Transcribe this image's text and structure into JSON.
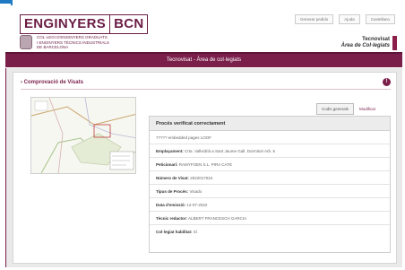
{
  "header": {
    "logo_left": "ENGINYERS",
    "logo_right": "BCN",
    "sub_line1": "COL·LEGI D'ENGINYERS GRADUATS",
    "sub_line2": "I ENGINYERS TÈCNICS INDUSTRIALS",
    "sub_line3": "DE BARCELONA",
    "links": [
      "Generar pedido",
      "Ajuda",
      "Castellano"
    ],
    "brand_line1": "Tecnovisat",
    "brand_line2": "Àrea de Col·legiats"
  },
  "nav": {
    "title": "Tecnovisat - Àrea de col·legiats"
  },
  "page": {
    "title": "Comprovació de Visats",
    "info_icon": "!",
    "buttons": {
      "print": "Codis generals",
      "back": "Modificar"
    }
  },
  "panel": {
    "heading": "Procés verificat correctament",
    "rows": [
      {
        "label": "",
        "value": "????? embedded pages LOOF"
      },
      {
        "label": "Emplaçament:",
        "value": "Crta. Vallvidrià a Sant Jaume Gall. Dormitori Arb. 5"
      },
      {
        "label": "Peticionari:",
        "value": "RAMYFOEN S.L. PIRA CATE"
      },
      {
        "label": "Número de Visat:",
        "value": "2022017024"
      },
      {
        "label": "Tipus de Procés:",
        "value": "Visado"
      },
      {
        "label": "Data d'emissió:",
        "value": "12-07-2022"
      },
      {
        "label": "Tècnic redactor:",
        "value": "ALBERT FRANCESCH GARCIA"
      },
      {
        "label": "Col·legiat habilitat:",
        "value": "Sí"
      }
    ]
  },
  "colors": {
    "brand": "#7a1e4a",
    "accent_blue": "#1f7ac4"
  },
  "icons": {
    "info": "info-icon",
    "seal": "seal-icon",
    "map": "map-thumbnail"
  }
}
